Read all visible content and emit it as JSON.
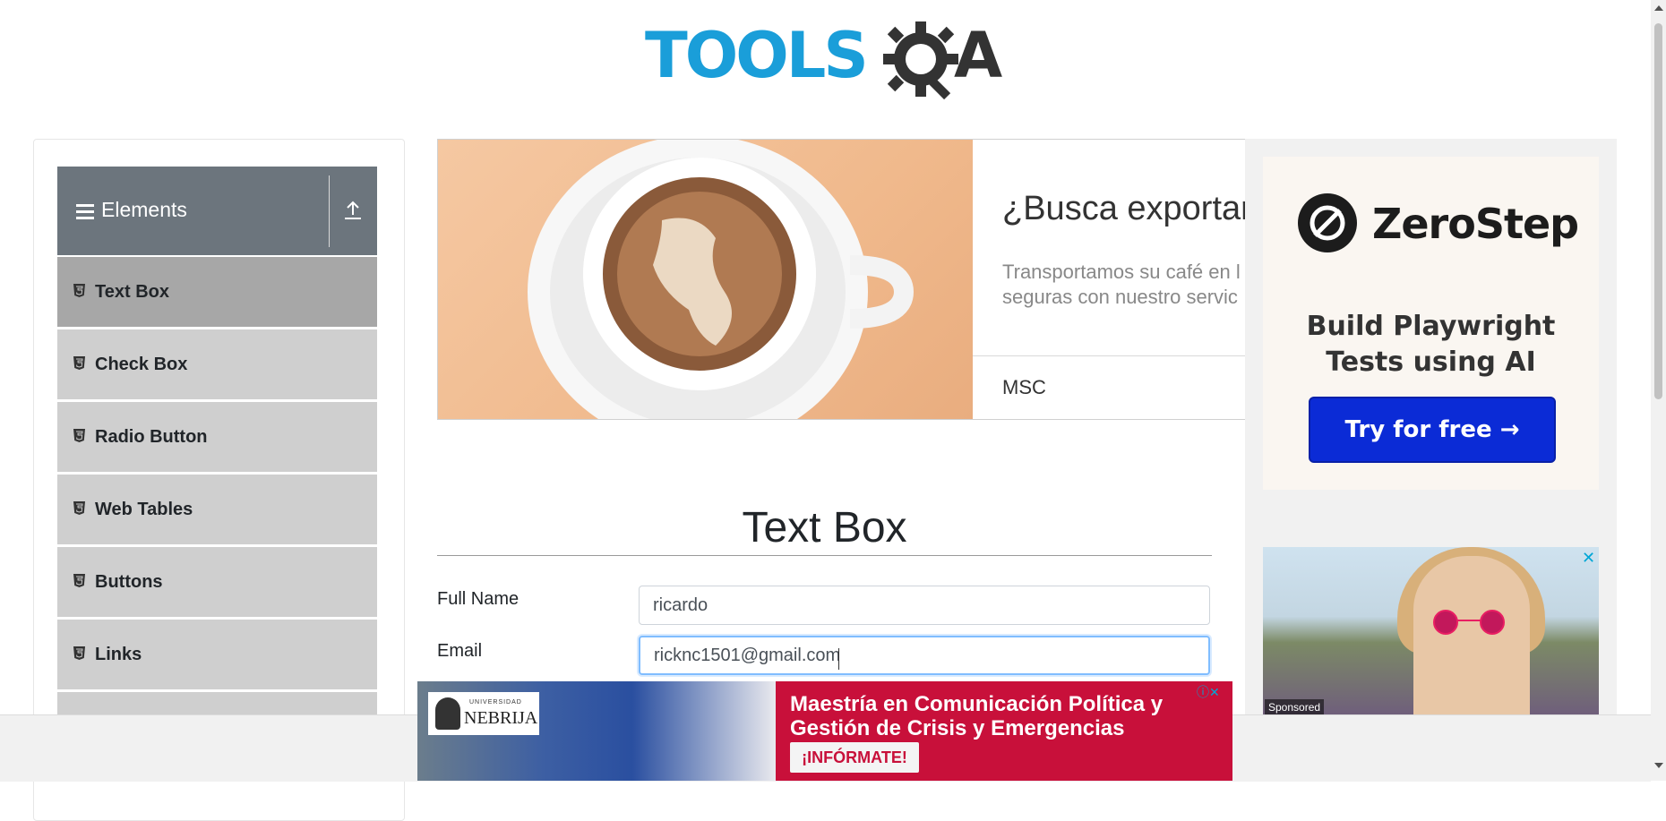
{
  "logo": {
    "text": "TOOLS",
    "accent": "A",
    "brand_color": "#1a9ed9"
  },
  "sidebar": {
    "group_title": "Elements",
    "items": [
      {
        "label": "Text Box",
        "active": true
      },
      {
        "label": "Check Box",
        "active": false
      },
      {
        "label": "Radio Button",
        "active": false
      },
      {
        "label": "Web Tables",
        "active": false
      },
      {
        "label": "Buttons",
        "active": false
      },
      {
        "label": "Links",
        "active": false
      }
    ]
  },
  "ad_top": {
    "headline": "¿Busca exportar",
    "description_line1": "Transportamos su café en l",
    "description_line2": "seguras con nuestro servic",
    "brand": "MSC"
  },
  "ad_right": {
    "brand": "ZeroStep",
    "tagline_line1": "Build Playwright",
    "tagline_line2": "Tests using AI",
    "cta": "Try for free →",
    "sponsored": "Sponsored",
    "close": "✕"
  },
  "form": {
    "title": "Text Box",
    "full_name_label": "Full Name",
    "full_name_value": "ricardo",
    "email_label": "Email",
    "email_value": "ricknc1501@gmail.com"
  },
  "ad_bottom": {
    "logo_small": "UNIVERSIDAD",
    "logo_name": "NEBRIJA",
    "headline": "Maestría en Comunicación Política y Gestión de Crisis y Emergencias",
    "cta": "¡INFÓRMATE!",
    "adchoices": "ⓘ✕"
  },
  "colors": {
    "sidebar_header": "#6c757d",
    "sidebar_active": "#a7a7a7",
    "sidebar_item": "#cfcfcf",
    "cta_blue": "#0b2bd6",
    "ad_red": "#c8103a",
    "focus_border": "#80bdff"
  }
}
